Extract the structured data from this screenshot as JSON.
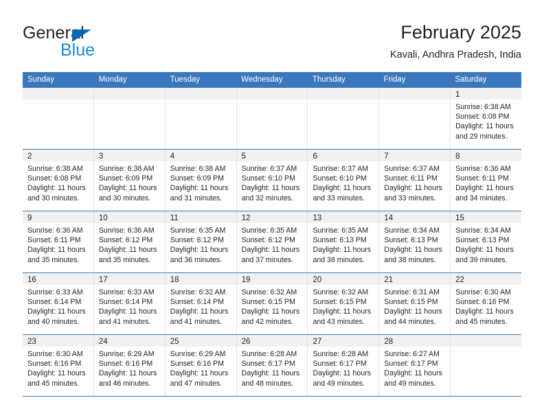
{
  "brand": {
    "name_part1": "General",
    "name_part2": "Blue",
    "triangle_icon": "triangle-icon",
    "accent_color": "#0b67b2",
    "blue_text_color": "#1c8ad6"
  },
  "header": {
    "title": "February 2025",
    "subtitle": "Kavali, Andhra Pradesh, India"
  },
  "theme": {
    "header_bar_color": "#3b77bc",
    "day_band_color": "#f1f1f1",
    "text_color": "#231f20",
    "grid_line_color": "#e3e3e3"
  },
  "weekdays": [
    "Sunday",
    "Monday",
    "Tuesday",
    "Wednesday",
    "Thursday",
    "Friday",
    "Saturday"
  ],
  "weeks": [
    [
      {
        "day": "",
        "sunrise": "",
        "sunset": "",
        "daylight_line1": "",
        "daylight_line2": ""
      },
      {
        "day": "",
        "sunrise": "",
        "sunset": "",
        "daylight_line1": "",
        "daylight_line2": ""
      },
      {
        "day": "",
        "sunrise": "",
        "sunset": "",
        "daylight_line1": "",
        "daylight_line2": ""
      },
      {
        "day": "",
        "sunrise": "",
        "sunset": "",
        "daylight_line1": "",
        "daylight_line2": ""
      },
      {
        "day": "",
        "sunrise": "",
        "sunset": "",
        "daylight_line1": "",
        "daylight_line2": ""
      },
      {
        "day": "",
        "sunrise": "",
        "sunset": "",
        "daylight_line1": "",
        "daylight_line2": ""
      },
      {
        "day": "1",
        "sunrise": "Sunrise: 6:38 AM",
        "sunset": "Sunset: 6:08 PM",
        "daylight_line1": "Daylight: 11 hours",
        "daylight_line2": "and 29 minutes."
      }
    ],
    [
      {
        "day": "2",
        "sunrise": "Sunrise: 6:38 AM",
        "sunset": "Sunset: 6:08 PM",
        "daylight_line1": "Daylight: 11 hours",
        "daylight_line2": "and 30 minutes."
      },
      {
        "day": "3",
        "sunrise": "Sunrise: 6:38 AM",
        "sunset": "Sunset: 6:09 PM",
        "daylight_line1": "Daylight: 11 hours",
        "daylight_line2": "and 30 minutes."
      },
      {
        "day": "4",
        "sunrise": "Sunrise: 6:38 AM",
        "sunset": "Sunset: 6:09 PM",
        "daylight_line1": "Daylight: 11 hours",
        "daylight_line2": "and 31 minutes."
      },
      {
        "day": "5",
        "sunrise": "Sunrise: 6:37 AM",
        "sunset": "Sunset: 6:10 PM",
        "daylight_line1": "Daylight: 11 hours",
        "daylight_line2": "and 32 minutes."
      },
      {
        "day": "6",
        "sunrise": "Sunrise: 6:37 AM",
        "sunset": "Sunset: 6:10 PM",
        "daylight_line1": "Daylight: 11 hours",
        "daylight_line2": "and 33 minutes."
      },
      {
        "day": "7",
        "sunrise": "Sunrise: 6:37 AM",
        "sunset": "Sunset: 6:11 PM",
        "daylight_line1": "Daylight: 11 hours",
        "daylight_line2": "and 33 minutes."
      },
      {
        "day": "8",
        "sunrise": "Sunrise: 6:36 AM",
        "sunset": "Sunset: 6:11 PM",
        "daylight_line1": "Daylight: 11 hours",
        "daylight_line2": "and 34 minutes."
      }
    ],
    [
      {
        "day": "9",
        "sunrise": "Sunrise: 6:36 AM",
        "sunset": "Sunset: 6:11 PM",
        "daylight_line1": "Daylight: 11 hours",
        "daylight_line2": "and 35 minutes."
      },
      {
        "day": "10",
        "sunrise": "Sunrise: 6:36 AM",
        "sunset": "Sunset: 6:12 PM",
        "daylight_line1": "Daylight: 11 hours",
        "daylight_line2": "and 35 minutes."
      },
      {
        "day": "11",
        "sunrise": "Sunrise: 6:35 AM",
        "sunset": "Sunset: 6:12 PM",
        "daylight_line1": "Daylight: 11 hours",
        "daylight_line2": "and 36 minutes."
      },
      {
        "day": "12",
        "sunrise": "Sunrise: 6:35 AM",
        "sunset": "Sunset: 6:12 PM",
        "daylight_line1": "Daylight: 11 hours",
        "daylight_line2": "and 37 minutes."
      },
      {
        "day": "13",
        "sunrise": "Sunrise: 6:35 AM",
        "sunset": "Sunset: 6:13 PM",
        "daylight_line1": "Daylight: 11 hours",
        "daylight_line2": "and 38 minutes."
      },
      {
        "day": "14",
        "sunrise": "Sunrise: 6:34 AM",
        "sunset": "Sunset: 6:13 PM",
        "daylight_line1": "Daylight: 11 hours",
        "daylight_line2": "and 38 minutes."
      },
      {
        "day": "15",
        "sunrise": "Sunrise: 6:34 AM",
        "sunset": "Sunset: 6:13 PM",
        "daylight_line1": "Daylight: 11 hours",
        "daylight_line2": "and 39 minutes."
      }
    ],
    [
      {
        "day": "16",
        "sunrise": "Sunrise: 6:33 AM",
        "sunset": "Sunset: 6:14 PM",
        "daylight_line1": "Daylight: 11 hours",
        "daylight_line2": "and 40 minutes."
      },
      {
        "day": "17",
        "sunrise": "Sunrise: 6:33 AM",
        "sunset": "Sunset: 6:14 PM",
        "daylight_line1": "Daylight: 11 hours",
        "daylight_line2": "and 41 minutes."
      },
      {
        "day": "18",
        "sunrise": "Sunrise: 6:32 AM",
        "sunset": "Sunset: 6:14 PM",
        "daylight_line1": "Daylight: 11 hours",
        "daylight_line2": "and 41 minutes."
      },
      {
        "day": "19",
        "sunrise": "Sunrise: 6:32 AM",
        "sunset": "Sunset: 6:15 PM",
        "daylight_line1": "Daylight: 11 hours",
        "daylight_line2": "and 42 minutes."
      },
      {
        "day": "20",
        "sunrise": "Sunrise: 6:32 AM",
        "sunset": "Sunset: 6:15 PM",
        "daylight_line1": "Daylight: 11 hours",
        "daylight_line2": "and 43 minutes."
      },
      {
        "day": "21",
        "sunrise": "Sunrise: 6:31 AM",
        "sunset": "Sunset: 6:15 PM",
        "daylight_line1": "Daylight: 11 hours",
        "daylight_line2": "and 44 minutes."
      },
      {
        "day": "22",
        "sunrise": "Sunrise: 6:30 AM",
        "sunset": "Sunset: 6:16 PM",
        "daylight_line1": "Daylight: 11 hours",
        "daylight_line2": "and 45 minutes."
      }
    ],
    [
      {
        "day": "23",
        "sunrise": "Sunrise: 6:30 AM",
        "sunset": "Sunset: 6:16 PM",
        "daylight_line1": "Daylight: 11 hours",
        "daylight_line2": "and 45 minutes."
      },
      {
        "day": "24",
        "sunrise": "Sunrise: 6:29 AM",
        "sunset": "Sunset: 6:16 PM",
        "daylight_line1": "Daylight: 11 hours",
        "daylight_line2": "and 46 minutes."
      },
      {
        "day": "25",
        "sunrise": "Sunrise: 6:29 AM",
        "sunset": "Sunset: 6:16 PM",
        "daylight_line1": "Daylight: 11 hours",
        "daylight_line2": "and 47 minutes."
      },
      {
        "day": "26",
        "sunrise": "Sunrise: 6:28 AM",
        "sunset": "Sunset: 6:17 PM",
        "daylight_line1": "Daylight: 11 hours",
        "daylight_line2": "and 48 minutes."
      },
      {
        "day": "27",
        "sunrise": "Sunrise: 6:28 AM",
        "sunset": "Sunset: 6:17 PM",
        "daylight_line1": "Daylight: 11 hours",
        "daylight_line2": "and 49 minutes."
      },
      {
        "day": "28",
        "sunrise": "Sunrise: 6:27 AM",
        "sunset": "Sunset: 6:17 PM",
        "daylight_line1": "Daylight: 11 hours",
        "daylight_line2": "and 49 minutes."
      },
      {
        "day": "",
        "sunrise": "",
        "sunset": "",
        "daylight_line1": "",
        "daylight_line2": ""
      }
    ]
  ]
}
